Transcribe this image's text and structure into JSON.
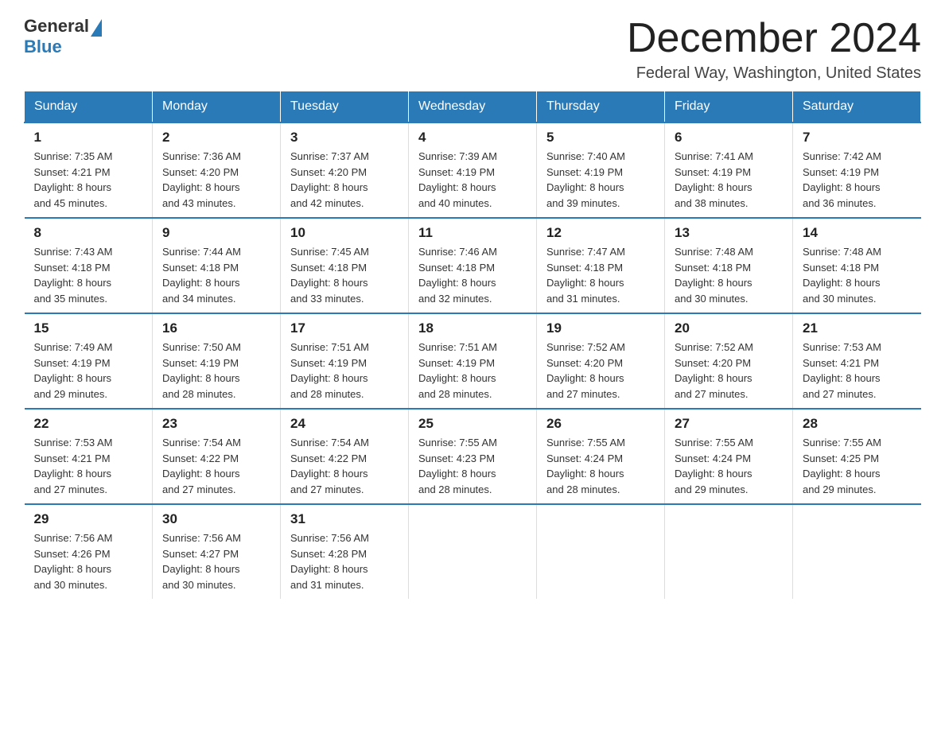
{
  "header": {
    "logo": {
      "general": "General",
      "blue": "Blue"
    },
    "title": "December 2024",
    "subtitle": "Federal Way, Washington, United States"
  },
  "days_of_week": [
    "Sunday",
    "Monday",
    "Tuesday",
    "Wednesday",
    "Thursday",
    "Friday",
    "Saturday"
  ],
  "weeks": [
    [
      {
        "day": "1",
        "sunrise": "7:35 AM",
        "sunset": "4:21 PM",
        "daylight": "8 hours and 45 minutes."
      },
      {
        "day": "2",
        "sunrise": "7:36 AM",
        "sunset": "4:20 PM",
        "daylight": "8 hours and 43 minutes."
      },
      {
        "day": "3",
        "sunrise": "7:37 AM",
        "sunset": "4:20 PM",
        "daylight": "8 hours and 42 minutes."
      },
      {
        "day": "4",
        "sunrise": "7:39 AM",
        "sunset": "4:19 PM",
        "daylight": "8 hours and 40 minutes."
      },
      {
        "day": "5",
        "sunrise": "7:40 AM",
        "sunset": "4:19 PM",
        "daylight": "8 hours and 39 minutes."
      },
      {
        "day": "6",
        "sunrise": "7:41 AM",
        "sunset": "4:19 PM",
        "daylight": "8 hours and 38 minutes."
      },
      {
        "day": "7",
        "sunrise": "7:42 AM",
        "sunset": "4:19 PM",
        "daylight": "8 hours and 36 minutes."
      }
    ],
    [
      {
        "day": "8",
        "sunrise": "7:43 AM",
        "sunset": "4:18 PM",
        "daylight": "8 hours and 35 minutes."
      },
      {
        "day": "9",
        "sunrise": "7:44 AM",
        "sunset": "4:18 PM",
        "daylight": "8 hours and 34 minutes."
      },
      {
        "day": "10",
        "sunrise": "7:45 AM",
        "sunset": "4:18 PM",
        "daylight": "8 hours and 33 minutes."
      },
      {
        "day": "11",
        "sunrise": "7:46 AM",
        "sunset": "4:18 PM",
        "daylight": "8 hours and 32 minutes."
      },
      {
        "day": "12",
        "sunrise": "7:47 AM",
        "sunset": "4:18 PM",
        "daylight": "8 hours and 31 minutes."
      },
      {
        "day": "13",
        "sunrise": "7:48 AM",
        "sunset": "4:18 PM",
        "daylight": "8 hours and 30 minutes."
      },
      {
        "day": "14",
        "sunrise": "7:48 AM",
        "sunset": "4:18 PM",
        "daylight": "8 hours and 30 minutes."
      }
    ],
    [
      {
        "day": "15",
        "sunrise": "7:49 AM",
        "sunset": "4:19 PM",
        "daylight": "8 hours and 29 minutes."
      },
      {
        "day": "16",
        "sunrise": "7:50 AM",
        "sunset": "4:19 PM",
        "daylight": "8 hours and 28 minutes."
      },
      {
        "day": "17",
        "sunrise": "7:51 AM",
        "sunset": "4:19 PM",
        "daylight": "8 hours and 28 minutes."
      },
      {
        "day": "18",
        "sunrise": "7:51 AM",
        "sunset": "4:19 PM",
        "daylight": "8 hours and 28 minutes."
      },
      {
        "day": "19",
        "sunrise": "7:52 AM",
        "sunset": "4:20 PM",
        "daylight": "8 hours and 27 minutes."
      },
      {
        "day": "20",
        "sunrise": "7:52 AM",
        "sunset": "4:20 PM",
        "daylight": "8 hours and 27 minutes."
      },
      {
        "day": "21",
        "sunrise": "7:53 AM",
        "sunset": "4:21 PM",
        "daylight": "8 hours and 27 minutes."
      }
    ],
    [
      {
        "day": "22",
        "sunrise": "7:53 AM",
        "sunset": "4:21 PM",
        "daylight": "8 hours and 27 minutes."
      },
      {
        "day": "23",
        "sunrise": "7:54 AM",
        "sunset": "4:22 PM",
        "daylight": "8 hours and 27 minutes."
      },
      {
        "day": "24",
        "sunrise": "7:54 AM",
        "sunset": "4:22 PM",
        "daylight": "8 hours and 27 minutes."
      },
      {
        "day": "25",
        "sunrise": "7:55 AM",
        "sunset": "4:23 PM",
        "daylight": "8 hours and 28 minutes."
      },
      {
        "day": "26",
        "sunrise": "7:55 AM",
        "sunset": "4:24 PM",
        "daylight": "8 hours and 28 minutes."
      },
      {
        "day": "27",
        "sunrise": "7:55 AM",
        "sunset": "4:24 PM",
        "daylight": "8 hours and 29 minutes."
      },
      {
        "day": "28",
        "sunrise": "7:55 AM",
        "sunset": "4:25 PM",
        "daylight": "8 hours and 29 minutes."
      }
    ],
    [
      {
        "day": "29",
        "sunrise": "7:56 AM",
        "sunset": "4:26 PM",
        "daylight": "8 hours and 30 minutes."
      },
      {
        "day": "30",
        "sunrise": "7:56 AM",
        "sunset": "4:27 PM",
        "daylight": "8 hours and 30 minutes."
      },
      {
        "day": "31",
        "sunrise": "7:56 AM",
        "sunset": "4:28 PM",
        "daylight": "8 hours and 31 minutes."
      },
      null,
      null,
      null,
      null
    ]
  ],
  "labels": {
    "sunrise": "Sunrise:",
    "sunset": "Sunset:",
    "daylight": "Daylight:"
  },
  "colors": {
    "header_bg": "#2a7ab8",
    "border": "#2a7ab8"
  }
}
